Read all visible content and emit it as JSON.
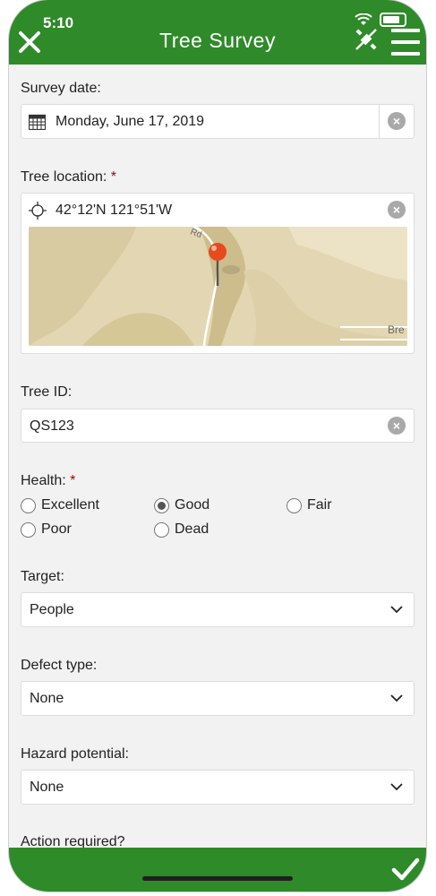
{
  "status": {
    "time": "5:10"
  },
  "header": {
    "title": "Tree Survey"
  },
  "survey_date": {
    "label": "Survey date:",
    "value": "Monday, June 17, 2019"
  },
  "tree_location": {
    "label": "Tree location:",
    "required_marker": "*",
    "value": "42°12'N 121°51'W",
    "map_labels": [
      "Rd",
      "Bre"
    ]
  },
  "tree_id": {
    "label": "Tree ID:",
    "value": "QS123"
  },
  "health": {
    "label": "Health:",
    "required_marker": "*",
    "options": [
      "Excellent",
      "Good",
      "Fair",
      "Poor",
      "Dead"
    ],
    "selected": "Good"
  },
  "target": {
    "label": "Target:",
    "value": "People"
  },
  "defect_type": {
    "label": "Defect type:",
    "value": "None"
  },
  "hazard_potential": {
    "label": "Hazard potential:",
    "value": "None"
  },
  "action_required": {
    "label": "Action required?"
  },
  "colors": {
    "header_green": "#2f8a2a",
    "background": "#f2f2f2",
    "required": "#b00000",
    "pin": "#e8491d"
  }
}
